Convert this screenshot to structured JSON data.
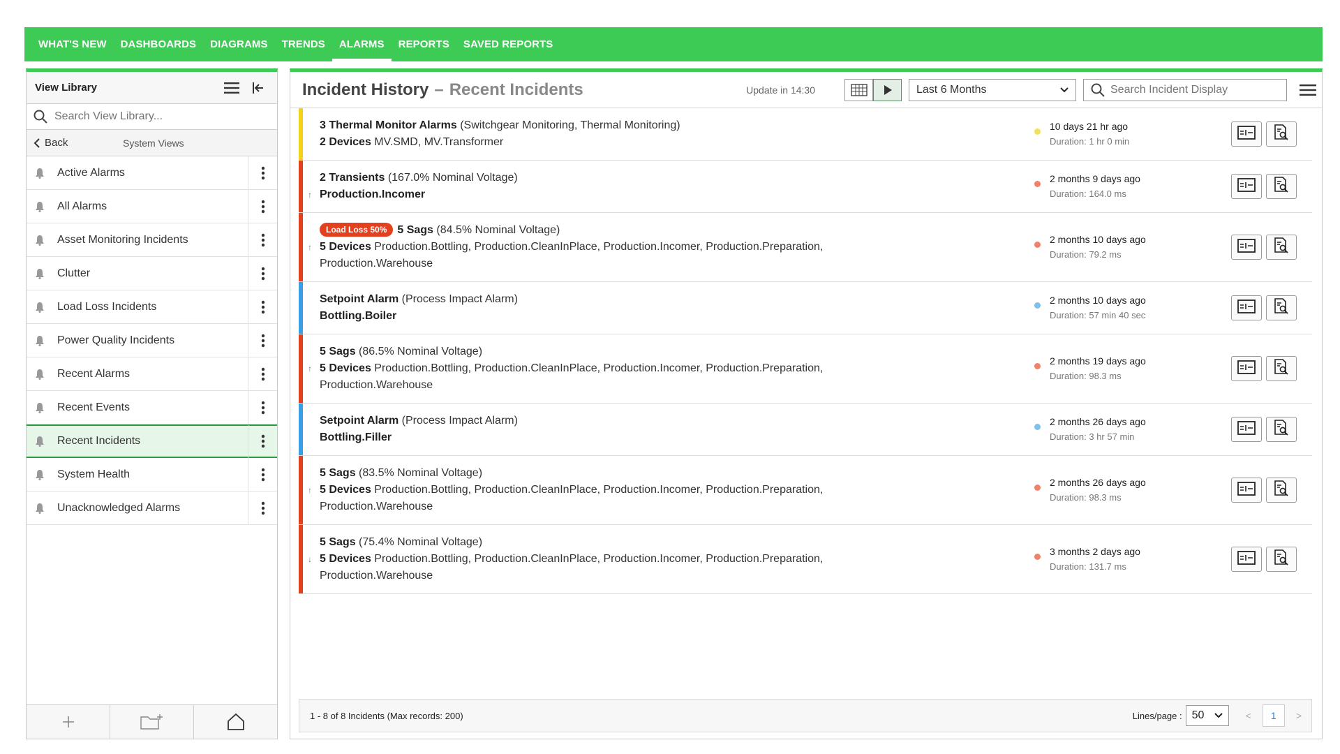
{
  "nav": {
    "items": [
      {
        "label": "WHAT'S NEW",
        "name": "nav-whats-new"
      },
      {
        "label": "DASHBOARDS",
        "name": "nav-dashboards"
      },
      {
        "label": "DIAGRAMS",
        "name": "nav-diagrams"
      },
      {
        "label": "TRENDS",
        "name": "nav-trends"
      },
      {
        "label": "ALARMS",
        "name": "nav-alarms",
        "active": true
      },
      {
        "label": "REPORTS",
        "name": "nav-reports"
      },
      {
        "label": "SAVED REPORTS",
        "name": "nav-saved-reports"
      }
    ]
  },
  "library": {
    "title": "View Library",
    "search_placeholder": "Search View Library...",
    "back_label": "Back",
    "section_label": "System Views",
    "items": [
      {
        "label": "Active Alarms"
      },
      {
        "label": "All Alarms"
      },
      {
        "label": "Asset Monitoring Incidents"
      },
      {
        "label": "Clutter"
      },
      {
        "label": "Load Loss Incidents"
      },
      {
        "label": "Power Quality Incidents"
      },
      {
        "label": "Recent Alarms"
      },
      {
        "label": "Recent Events"
      },
      {
        "label": "Recent Incidents",
        "selected": true
      },
      {
        "label": "System Health"
      },
      {
        "label": "Unacknowledged Alarms"
      }
    ]
  },
  "header": {
    "title": "Incident History",
    "separator": "–",
    "subtitle": "Recent Incidents",
    "update_text": "Update in 14:30",
    "range_value": "Last 6 Months",
    "search_placeholder": "Search Incident Display"
  },
  "colors": {
    "green": "#3dcb55",
    "yellow": "#f2d21b",
    "red": "#e2401e",
    "blue": "#3a9ee4",
    "dot_yellow": "#f2e25b",
    "dot_orange": "#f0826a",
    "dot_blue": "#7fc0ec"
  },
  "incidents": [
    {
      "severity": "yellow",
      "arrow": "",
      "badge": "",
      "bold": "3 Thermal Monitor Alarms",
      "detail": " (Switchgear Monitoring, Thermal Monitoring)",
      "line2_bold": "2 Devices",
      "line2": " MV.SMD, MV.Transformer",
      "line3": "",
      "when": "10 days 21 hr ago",
      "duration": "Duration: 1 hr 0 min"
    },
    {
      "severity": "red",
      "arrow": "↑",
      "badge": "",
      "bold": "2 Transients",
      "detail": " (167.0% Nominal Voltage)",
      "line2_bold": "Production.Incomer",
      "line2": "",
      "line3": "",
      "when": "2 months 9 days ago",
      "duration": "Duration: 164.0 ms"
    },
    {
      "severity": "red",
      "arrow": "↑",
      "badge": "Load Loss 50%",
      "bold": "5 Sags",
      "detail": " (84.5% Nominal Voltage)",
      "line2_bold": "5 Devices",
      "line2": " Production.Bottling, Production.CleanInPlace, Production.Incomer, Production.Preparation,",
      "line3": "Production.Warehouse",
      "when": "2 months 10 days ago",
      "duration": "Duration: 79.2 ms"
    },
    {
      "severity": "blue",
      "arrow": "",
      "badge": "",
      "bold": "Setpoint Alarm",
      "detail": " (Process Impact Alarm)",
      "line2_bold": "Bottling.Boiler",
      "line2": "",
      "line3": "",
      "when": "2 months 10 days ago",
      "duration": "Duration: 57 min 40 sec"
    },
    {
      "severity": "red",
      "arrow": "↑",
      "badge": "",
      "bold": "5 Sags",
      "detail": " (86.5% Nominal Voltage)",
      "line2_bold": "5 Devices",
      "line2": " Production.Bottling, Production.CleanInPlace, Production.Incomer, Production.Preparation,",
      "line3": "Production.Warehouse",
      "when": "2 months 19 days ago",
      "duration": "Duration: 98.3 ms"
    },
    {
      "severity": "blue",
      "arrow": "",
      "badge": "",
      "bold": "Setpoint Alarm",
      "detail": " (Process Impact Alarm)",
      "line2_bold": "Bottling.Filler",
      "line2": "",
      "line3": "",
      "when": "2 months 26 days ago",
      "duration": "Duration: 3 hr 57 min"
    },
    {
      "severity": "red",
      "arrow": "↑",
      "badge": "",
      "bold": "5 Sags",
      "detail": " (83.5% Nominal Voltage)",
      "line2_bold": "5 Devices",
      "line2": " Production.Bottling, Production.CleanInPlace, Production.Incomer, Production.Preparation,",
      "line3": "Production.Warehouse",
      "when": "2 months 26 days ago",
      "duration": "Duration: 98.3 ms"
    },
    {
      "severity": "red",
      "arrow": "↓",
      "badge": "",
      "bold": "5 Sags",
      "detail": " (75.4% Nominal Voltage)",
      "line2_bold": "5 Devices",
      "line2": " Production.Bottling, Production.CleanInPlace, Production.Incomer, Production.Preparation,",
      "line3": "Production.Warehouse",
      "when": "3 months 2 days ago",
      "duration": "Duration: 131.7 ms"
    }
  ],
  "footer": {
    "summary": "1 - 8 of 8 Incidents (Max records: 200)",
    "lines_label": "Lines/page :",
    "lines_value": "50",
    "page": "1",
    "prev": "<",
    "next": ">"
  }
}
